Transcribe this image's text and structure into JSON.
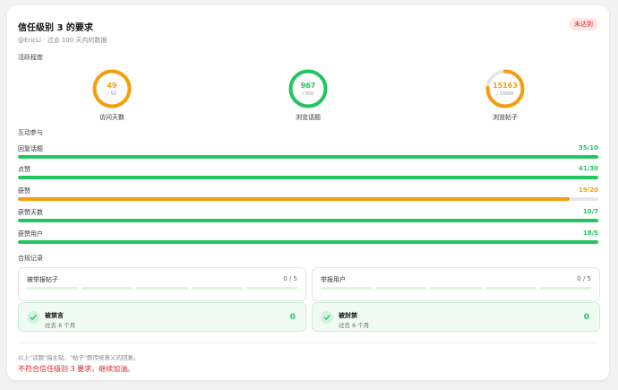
{
  "header": {
    "title": "信任级别 3 的要求",
    "badge": "未达到",
    "subtitle": "@EricLi · 过去 100 天内的数据"
  },
  "activity": {
    "label": "活跃程度",
    "items": [
      {
        "value": "49",
        "max": "/ 50",
        "label": "访问天数",
        "fraction": 0.98,
        "color": "#f59e0b"
      },
      {
        "value": "967",
        "max": "/ 500",
        "label": "浏览话题",
        "fraction": 1.0,
        "color": "#22c55e"
      },
      {
        "value": "15163",
        "max": "/ 20000",
        "label": "浏览帖子",
        "fraction": 0.758,
        "color": "#f59e0b"
      }
    ]
  },
  "interaction": {
    "label": "互动参与",
    "items": [
      {
        "label": "回复话题",
        "value": "35/10",
        "fraction": 1.0,
        "color": "#22c55e"
      },
      {
        "label": "点赞",
        "value": "41/30",
        "fraction": 1.0,
        "color": "#22c55e"
      },
      {
        "label": "获赞",
        "value": "19/20",
        "fraction": 0.95,
        "color": "#f59e0b"
      },
      {
        "label": "获赞天数",
        "value": "10/7",
        "fraction": 1.0,
        "color": "#22c55e"
      },
      {
        "label": "获赞用户",
        "value": "18/5",
        "fraction": 1.0,
        "color": "#22c55e"
      }
    ]
  },
  "compliance": {
    "label": "合规记录",
    "reported_posts": {
      "label": "被举报帖子",
      "count": "0 / 5"
    },
    "reporting_users": {
      "label": "举报用户",
      "count": "0 / 5"
    },
    "silenced": {
      "title": "被禁言",
      "sub": "过去 6 个月",
      "count": "0"
    },
    "suspended": {
      "title": "被封禁",
      "sub": "过去 6 个月",
      "count": "0"
    }
  },
  "footer": {
    "note": "以上\"话题\"指主贴，\"帖子\"即传统意义的回复。",
    "warning": "不符合信任级别 3 要求，继续加油。"
  }
}
